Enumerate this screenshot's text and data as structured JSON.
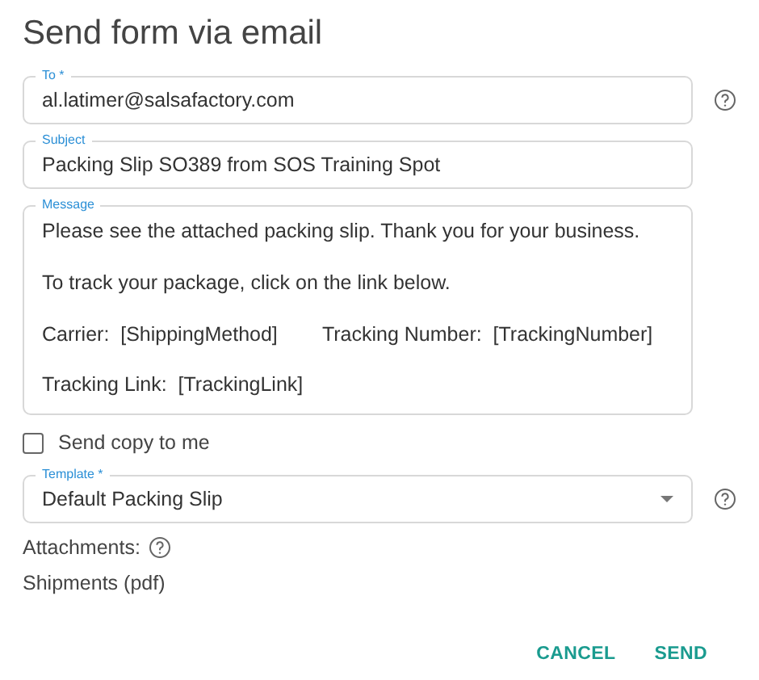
{
  "dialog": {
    "title": "Send form via email",
    "to": {
      "label": "To *",
      "value": "al.latimer@salsafactory.com"
    },
    "subject": {
      "label": "Subject",
      "value": "Packing Slip SO389 from SOS Training Spot"
    },
    "message": {
      "label": "Message",
      "value": "Please see the attached packing slip. Thank you for your business.\n\nTo track your package, click on the link below.\n\nCarrier:  [ShippingMethod]        Tracking Number:  [TrackingNumber]\n\nTracking Link:  [TrackingLink]"
    },
    "send_copy": {
      "label": "Send copy to me",
      "checked": false
    },
    "template": {
      "label": "Template *",
      "value": "Default Packing Slip"
    },
    "attachments_label": "Attachments:",
    "attachments": [
      "Shipments (pdf)"
    ],
    "buttons": [
      "CANCEL",
      "SEND"
    ]
  }
}
